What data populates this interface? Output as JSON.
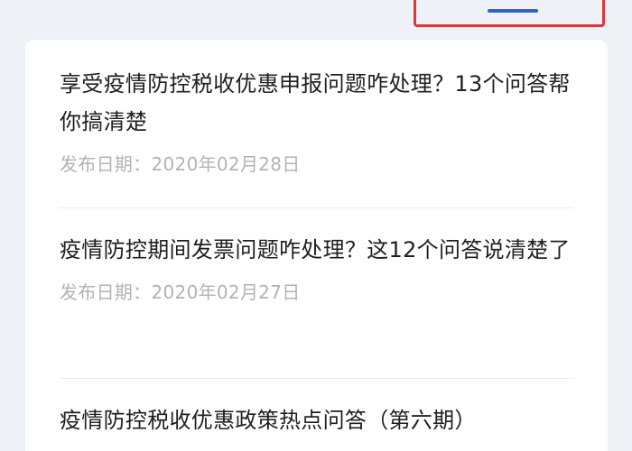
{
  "articles": [
    {
      "title": "享受疫情防控税收优惠申报问题咋处理？13个问答帮你搞清楚",
      "date": "发布日期：2020年02月28日"
    },
    {
      "title": "疫情防控期间发票问题咋处理？这12个问答说清楚了",
      "date": "发布日期：2020年02月27日"
    },
    {
      "title": "疫情防控税收优惠政策热点问答（第六期）",
      "date": ""
    }
  ],
  "colors": {
    "tab_highlight_border": "#e0353a",
    "tab_active_underline": "#2f63c8",
    "date_text": "#b3b3b3"
  }
}
